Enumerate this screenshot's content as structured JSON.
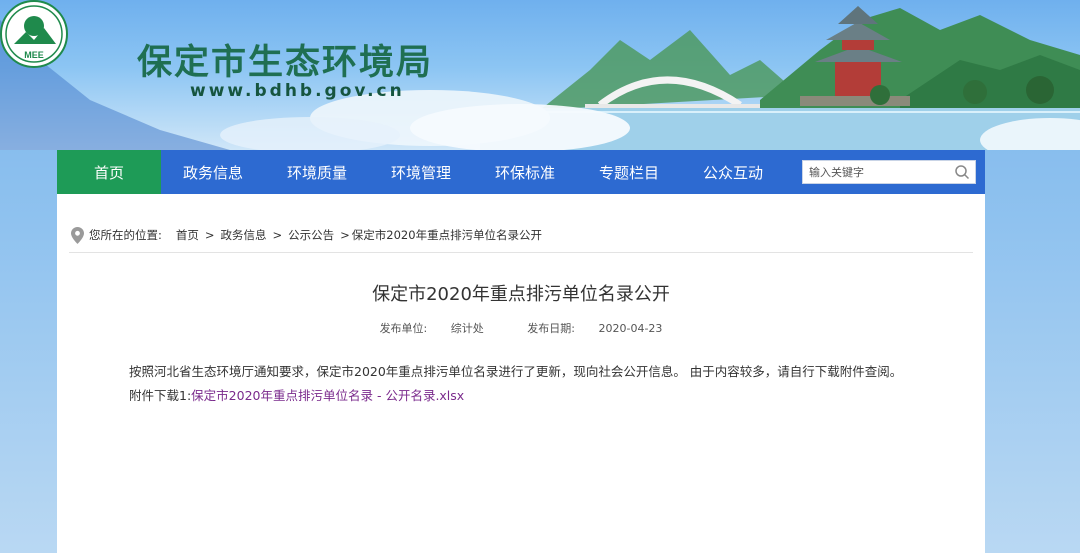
{
  "header": {
    "site_title": "保定市生态环境局",
    "site_url": "www.bdhb.gov.cn",
    "logo_text": "MEE"
  },
  "nav": {
    "items": [
      {
        "label": "首页",
        "active": true
      },
      {
        "label": "政务信息"
      },
      {
        "label": "环境质量"
      },
      {
        "label": "环境管理"
      },
      {
        "label": "环保标准"
      },
      {
        "label": "专题栏目"
      },
      {
        "label": "公众互动"
      }
    ],
    "search_placeholder": "输入关键字"
  },
  "breadcrumb": {
    "prefix": "您所在的位置:",
    "items": [
      "首页",
      "政务信息",
      "公示公告",
      "保定市2020年重点排污单位名录公开"
    ],
    "separator": ">"
  },
  "article": {
    "title": "保定市2020年重点排污单位名录公开",
    "publisher_label": "发布单位:",
    "publisher": "综计处",
    "date_label": "发布日期:",
    "date": "2020-04-23",
    "body": "按照河北省生态环境厅通知要求，保定市2020年重点排污单位名录进行了更新，现向社会公开信息。 由于内容较多，请自行下载附件查阅。",
    "attachment_label": "附件下载1:",
    "attachment_name": "保定市2020年重点排污单位名录 - 公开名录.xlsx"
  },
  "colors": {
    "nav_bg": "#2d6ad1",
    "nav_active": "#1e9b57",
    "title_green": "#1f6f52",
    "link_purple": "#7a2a8c"
  }
}
